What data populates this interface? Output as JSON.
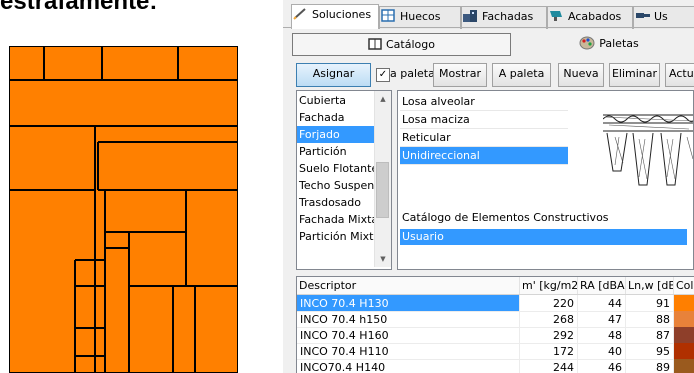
{
  "caption_fragment": "estrafamente:",
  "panel": {
    "tabs": [
      {
        "label": "Soluciones",
        "icon": "pencil-icon",
        "active": true
      },
      {
        "label": "Huecos",
        "icon": "window-icon",
        "active": false
      },
      {
        "label": "Fachadas",
        "icon": "building-icon",
        "active": false
      },
      {
        "label": "Acabados",
        "icon": "paint-icon",
        "active": false
      },
      {
        "label": "Us",
        "icon": "hammer-icon",
        "active": false
      }
    ],
    "subtabs": {
      "catalog": "Catálogo",
      "palettes": "Paletas"
    },
    "toolbar": {
      "assign": "Asignar",
      "to_palette_checkbox": "a paleta",
      "show": "Mostrar",
      "to_palette": "A paleta",
      "new": "Nueva",
      "delete": "Eliminar",
      "update": "Actua"
    },
    "element_types": {
      "items": [
        "Cubierta",
        "Fachada",
        "Forjado",
        "Partición",
        "Suelo Flotante",
        "Techo Suspendido",
        "Trasdosado",
        "Fachada Mixta",
        "Partición Mixta"
      ],
      "selected_index": 2
    },
    "subtypes": {
      "items": [
        "Losa alveolar",
        "Losa maciza",
        "Reticular",
        "Unidireccional"
      ],
      "selected_index": 3
    },
    "catalog": {
      "title": "Catálogo de Elementos Constructivos",
      "selected": "Usuario"
    },
    "table": {
      "columns": [
        "Descriptor",
        "m' [kg/m2]",
        "RA [dBA]",
        "Ln,w [dB]",
        "Colo"
      ],
      "rows": [
        {
          "descriptor": "INCO 70.4 H130",
          "mass": "220",
          "ra": "44",
          "lnw": "91",
          "color": "#ff7f00",
          "selected": true
        },
        {
          "descriptor": "INCO 70.4 h150",
          "mass": "268",
          "ra": "47",
          "lnw": "88",
          "color": "#e8823a",
          "selected": false
        },
        {
          "descriptor": "INCO 70.4 H160",
          "mass": "292",
          "ra": "48",
          "lnw": "87",
          "color": "#8e3f2a",
          "selected": false
        },
        {
          "descriptor": "INCO 70.4 H110",
          "mass": "172",
          "ra": "40",
          "lnw": "95",
          "color": "#b03000",
          "selected": false
        },
        {
          "descriptor": "INCO70.4 H140",
          "mass": "244",
          "ra": "46",
          "lnw": "89",
          "color": "#9a5a1e",
          "selected": false
        }
      ]
    }
  },
  "colors": {
    "floorplan_fill": "#ff8000",
    "selection": "#3399ff"
  }
}
